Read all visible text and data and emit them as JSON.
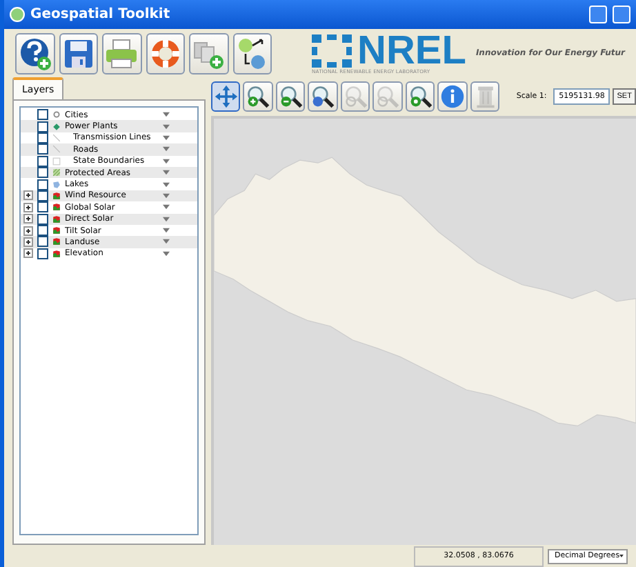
{
  "window": {
    "title": "Geospatial Toolkit"
  },
  "toolbar": [
    {
      "kind": "help"
    },
    {
      "kind": "save"
    },
    {
      "kind": "print"
    },
    {
      "kind": "lifebuoy"
    },
    {
      "kind": "add-layers"
    },
    {
      "kind": "network"
    }
  ],
  "logo": {
    "name": "NREL",
    "subtitle": "NATIONAL RENEWABLE ENERGY LABORATORY",
    "tagline": "Innovation for Our Energy Futur"
  },
  "layers_panel": {
    "tabs": [
      {
        "label": "Layers",
        "selected": true
      }
    ],
    "layers": [
      {
        "name": "Cities",
        "kind": "point",
        "checked": false,
        "expandable": false
      },
      {
        "name": "Power Plants",
        "kind": "plant",
        "checked": false,
        "expandable": false
      },
      {
        "name": "Transmission Lines",
        "kind": "line",
        "checked": false,
        "expandable": false
      },
      {
        "name": "Roads",
        "kind": "line",
        "checked": false,
        "expandable": false
      },
      {
        "name": "State Boundaries",
        "kind": "outline",
        "checked": false,
        "expandable": false
      },
      {
        "name": "Protected Areas",
        "kind": "hatch",
        "checked": false,
        "expandable": false
      },
      {
        "name": "Lakes",
        "kind": "water",
        "checked": false,
        "expandable": false
      },
      {
        "name": "Wind Resource",
        "kind": "raster",
        "checked": false,
        "expandable": true
      },
      {
        "name": "Global Solar",
        "kind": "raster",
        "checked": false,
        "expandable": true
      },
      {
        "name": "Direct Solar",
        "kind": "raster",
        "checked": false,
        "expandable": true
      },
      {
        "name": "Tilt Solar",
        "kind": "raster",
        "checked": false,
        "expandable": true
      },
      {
        "name": "Landuse",
        "kind": "raster",
        "checked": false,
        "expandable": true
      },
      {
        "name": "Elevation",
        "kind": "raster",
        "checked": false,
        "expandable": true
      }
    ]
  },
  "map_toolbar": {
    "tools": [
      {
        "kind": "pan",
        "selected": true,
        "disabled": false
      },
      {
        "kind": "zoom-in",
        "selected": false,
        "disabled": false
      },
      {
        "kind": "zoom-out",
        "selected": false,
        "disabled": false
      },
      {
        "kind": "zoom-full",
        "selected": false,
        "disabled": false
      },
      {
        "kind": "zoom-back",
        "selected": false,
        "disabled": true
      },
      {
        "kind": "zoom-forward",
        "selected": false,
        "disabled": true
      },
      {
        "kind": "zoom-layer",
        "selected": false,
        "disabled": false
      },
      {
        "kind": "info",
        "selected": false,
        "disabled": false
      },
      {
        "kind": "column",
        "selected": false,
        "disabled": true
      }
    ],
    "scale_label": "Scale 1:",
    "scale_value": "5195131.98",
    "set_button": "SET"
  },
  "status_bar": {
    "coordinates": "32.0508 , 83.0676",
    "units": "Decimal Degrees"
  }
}
